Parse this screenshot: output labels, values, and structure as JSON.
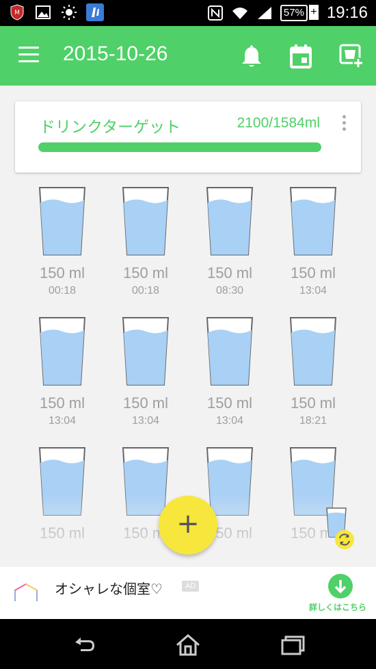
{
  "status_bar": {
    "battery": "57%",
    "time": "19:16",
    "icons": [
      "mcafee-icon",
      "image-icon",
      "brightness-icon",
      "app-icon",
      "nfc-icon",
      "wifi-icon",
      "signal-icon",
      "battery-icon"
    ]
  },
  "app_bar": {
    "title": "2015-10-26",
    "icons": [
      "menu-icon",
      "bell-icon",
      "calendar-icon",
      "add-cup-icon"
    ]
  },
  "target_card": {
    "title": "ドリンクターゲット",
    "value": "2100/1584ml",
    "progress_fraction": 1.0
  },
  "drinks": [
    {
      "amount": "150 ml",
      "time": "00:18"
    },
    {
      "amount": "150 ml",
      "time": "00:18"
    },
    {
      "amount": "150 ml",
      "time": "08:30"
    },
    {
      "amount": "150 ml",
      "time": "13:04"
    },
    {
      "amount": "150 ml",
      "time": "13:04"
    },
    {
      "amount": "150 ml",
      "time": "13:04"
    },
    {
      "amount": "150 ml",
      "time": "13:04"
    },
    {
      "amount": "150 ml",
      "time": "18:21"
    },
    {
      "amount": "150 ml",
      "time": ""
    },
    {
      "amount": "150 ml",
      "time": ""
    },
    {
      "amount": "150 ml",
      "time": ""
    },
    {
      "amount": "150 ml",
      "time": ""
    }
  ],
  "fab": {
    "label": "+"
  },
  "ad": {
    "title": "オシャレな個室♡",
    "badge": "AD",
    "cta": "詳しくはこちら"
  },
  "colors": {
    "accent": "#4fd068",
    "fab": "#f7e63c",
    "water": "#a9d0f5"
  }
}
